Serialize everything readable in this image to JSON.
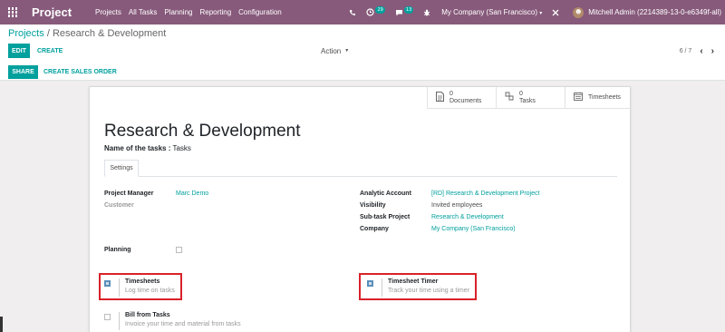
{
  "navbar": {
    "brand": "Project",
    "menu": [
      "Projects",
      "All Tasks",
      "Planning",
      "Reporting",
      "Configuration"
    ],
    "icons": [
      "phone-icon",
      "activity-icon",
      "chat-icon",
      "bug-icon",
      "timer-icon"
    ],
    "activity_badge": "29",
    "chat_badge": "13",
    "company": "My Company (San Francisco)",
    "user": "Mitchell Admin (2214389-13-0-e6349f-all)"
  },
  "control_panel": {
    "breadcrumb_parent": "Projects",
    "breadcrumb_sep": "/",
    "breadcrumb_current": "Research & Development",
    "edit_label": "EDIT",
    "create_label": "CREATE",
    "action_label": "Action",
    "pager": "6 / 7",
    "share_label": "SHARE",
    "sales_order_label": "CREATE SALES ORDER"
  },
  "stat_buttons": {
    "documents_count": "0",
    "documents_label": "Documents",
    "tasks_count": "0",
    "tasks_label": "Tasks",
    "timesheets_label": "Timesheets"
  },
  "form": {
    "title": "Research & Development",
    "tasks_name_label": "Name of the tasks :",
    "tasks_name_value": "Tasks",
    "tab_settings": "Settings",
    "left_fields": {
      "project_manager_label": "Project Manager",
      "project_manager_value": "Marc Demo",
      "customer_label": "Customer"
    },
    "right_fields": {
      "analytic_account_label": "Analytic Account",
      "analytic_account_value": "[RD] Research & Development Project",
      "visibility_label": "Visibility",
      "visibility_value": "Invited employees",
      "subtask_project_label": "Sub-task Project",
      "subtask_project_value": "Research & Development",
      "company_label": "Company",
      "company_value": "My Company (San Francisco)"
    },
    "planning_label": "Planning",
    "planning_checked": false,
    "options": {
      "timesheets_title": "Timesheets",
      "timesheets_desc": "Log time on tasks",
      "timesheets_checked": true,
      "timer_title": "Timesheet Timer",
      "timer_desc": "Track your time using a timer",
      "timer_checked": true,
      "bill_title": "Bill from Tasks",
      "bill_desc": "Invoice your time and material from tasks",
      "bill_checked": false
    }
  },
  "colors": {
    "navbar": "#875a7b",
    "accent": "#00a09d",
    "highlight": "#d9222a"
  }
}
